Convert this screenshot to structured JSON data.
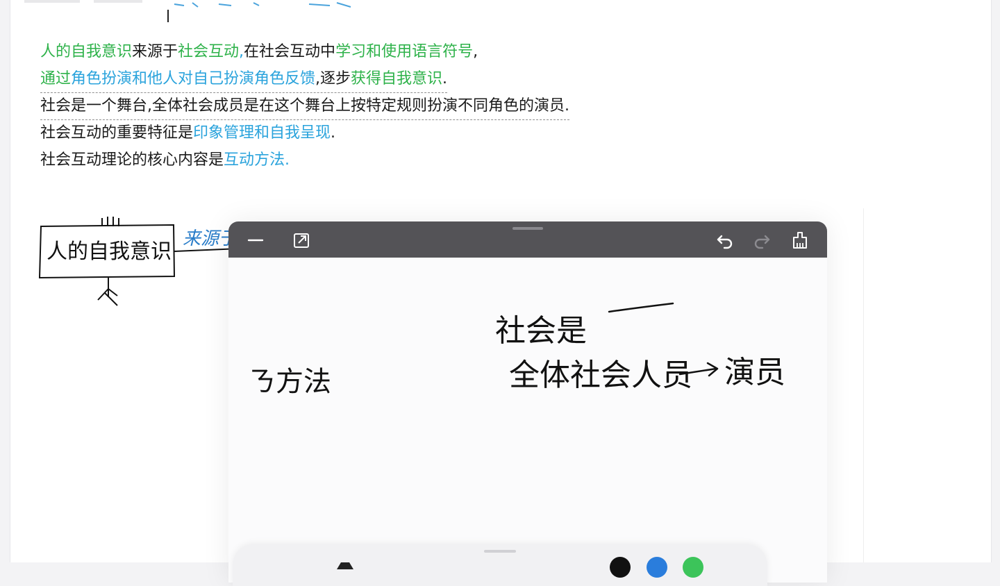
{
  "notes": {
    "line1": {
      "p1": "人的自我意识",
      "p2": "来源于",
      "p3": "社会互动",
      "p4": ",",
      "p5": "在社会互动中",
      "p6": "学习和使用语言符号",
      "p7": ","
    },
    "line2": {
      "p1": "通过",
      "p2": "角色扮演和他人对自己扮演角色反馈",
      "p3": ",逐步",
      "p4": "获得自我意识",
      "p5": "."
    },
    "line3": "社会是一个舞台,全体社会成员是在这个舞台上按特定规则扮演不同角色的演员.",
    "line4": {
      "p1": "社会互动的重要特征是",
      "p2": "印象管理和自我呈现",
      "p3": "."
    },
    "line5": {
      "p1": "社会互动理论的核心内容是",
      "p2": "互动方法."
    }
  },
  "left_drawing": {
    "box_label": "人的自我意识",
    "arrow_label": "来源于"
  },
  "panel": {
    "handwriting": {
      "method": "ㄋ方法",
      "society": "社会是",
      "members": "全体社会人员",
      "actors": "演员"
    },
    "icons": [
      "minimize-icon",
      "expand-icon",
      "undo-icon",
      "redo-icon",
      "clear-icon"
    ]
  },
  "colors": {
    "green": "#2eb24a",
    "blue": "#2aa3dc",
    "toolbar": "#545357"
  }
}
